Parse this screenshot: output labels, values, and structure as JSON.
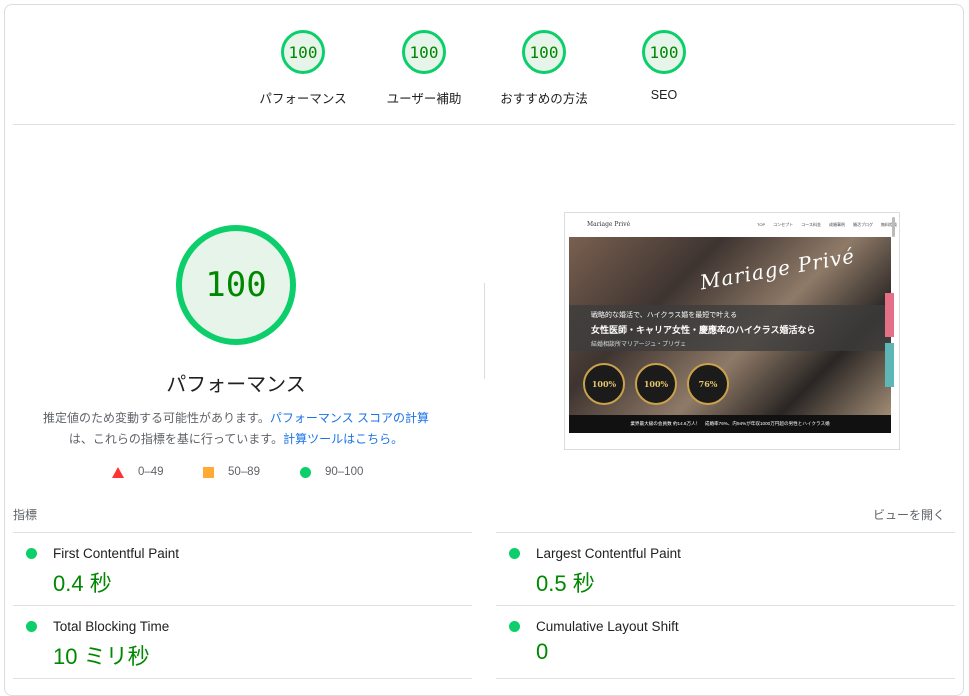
{
  "categories": [
    {
      "score": "100",
      "label": "パフォーマンス"
    },
    {
      "score": "100",
      "label": "ユーザー補助"
    },
    {
      "score": "100",
      "label": "おすすめの方法"
    },
    {
      "score": "100",
      "label": "SEO"
    }
  ],
  "performance": {
    "score": "100",
    "title": "パフォーマンス",
    "desc_line1_pre": "推定値のため変動する可能性があります。",
    "desc_link1": "パフォーマンス スコアの計算",
    "desc_line2_pre": "は、これらの指標を基に行っています。",
    "desc_link2": "計算ツールはこちら。"
  },
  "legend": [
    {
      "range": "0–49",
      "icon": "triangle-icon",
      "color": "#ff3333"
    },
    {
      "range": "50–89",
      "icon": "square-icon",
      "color": "#ffaa33"
    },
    {
      "range": "90–100",
      "icon": "circle-icon",
      "color": "#0cce6b"
    }
  ],
  "screenshot": {
    "logo": "Mariage Privé",
    "nav": [
      "TOP",
      "コンセプト",
      "コース料金",
      "成婚事例",
      "婚活ブログ",
      "無料相談"
    ],
    "script_title": "Mariage Privé",
    "line1": "戦略的な婚活で、ハイクラス婚を最短で叶える",
    "line2": "女性医師・キャリア女性・慶應卒のハイクラス婚活なら",
    "line3": "結婚相談所マリアージュ・プリヴェ",
    "badges": [
      "100%",
      "100%",
      "76%"
    ],
    "bottom": "業界最大級の会員数 約14.6万人！　成婚率76%、内94%が年収1000万円超の男性とハイクラス婚"
  },
  "metrics": {
    "header": "指標",
    "open_view": "ビューを開く",
    "items": [
      {
        "name": "First Contentful Paint",
        "value": "0.4 秒"
      },
      {
        "name": "Largest Contentful Paint",
        "value": "0.5 秒"
      },
      {
        "name": "Total Blocking Time",
        "value": "10 ミリ秒"
      },
      {
        "name": "Cumulative Layout Shift",
        "value": "0"
      }
    ]
  },
  "colors": {
    "pass": "#0cce6b",
    "pass_text": "#008800",
    "link": "#1a73e8"
  }
}
